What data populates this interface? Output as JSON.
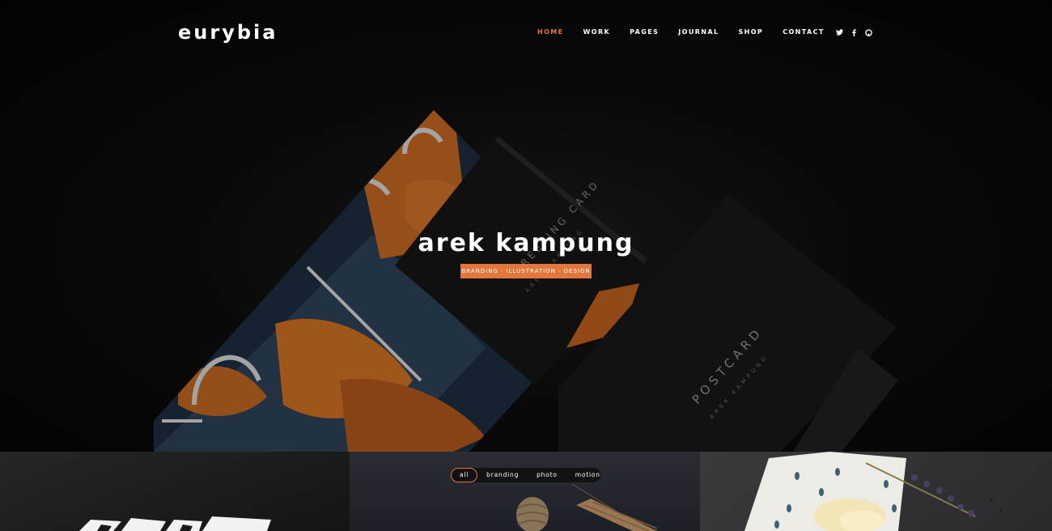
{
  "brand": {
    "logo": "eurybia",
    "accent": "#e2773b"
  },
  "nav": {
    "items": [
      {
        "label": "HOME",
        "active": true
      },
      {
        "label": "WORK",
        "active": false
      },
      {
        "label": "PAGES",
        "active": false
      },
      {
        "label": "JOURNAL",
        "active": false
      },
      {
        "label": "SHOP",
        "active": false
      },
      {
        "label": "CONTACT",
        "active": false
      }
    ]
  },
  "social": [
    {
      "icon": "twitter-icon",
      "glyph": "🐦"
    },
    {
      "icon": "facebook-icon",
      "glyph": "f"
    },
    {
      "icon": "github-icon",
      "glyph": "◉"
    }
  ],
  "hero": {
    "title": "arek kampung",
    "tagline": "BRANDING · ILLUSTRATION · DESIGN",
    "card_1": {
      "line1": "GREETING CARD",
      "line2": "AREK KAMPUNG"
    },
    "card_2": {
      "line1": "POSTCARD",
      "line2": "AREK KAMPUNG"
    }
  },
  "portfolio": {
    "filters": [
      {
        "label": "all",
        "active": true
      },
      {
        "label": "branding",
        "active": false
      },
      {
        "label": "photo",
        "active": false
      },
      {
        "label": "motion",
        "active": false
      }
    ]
  }
}
